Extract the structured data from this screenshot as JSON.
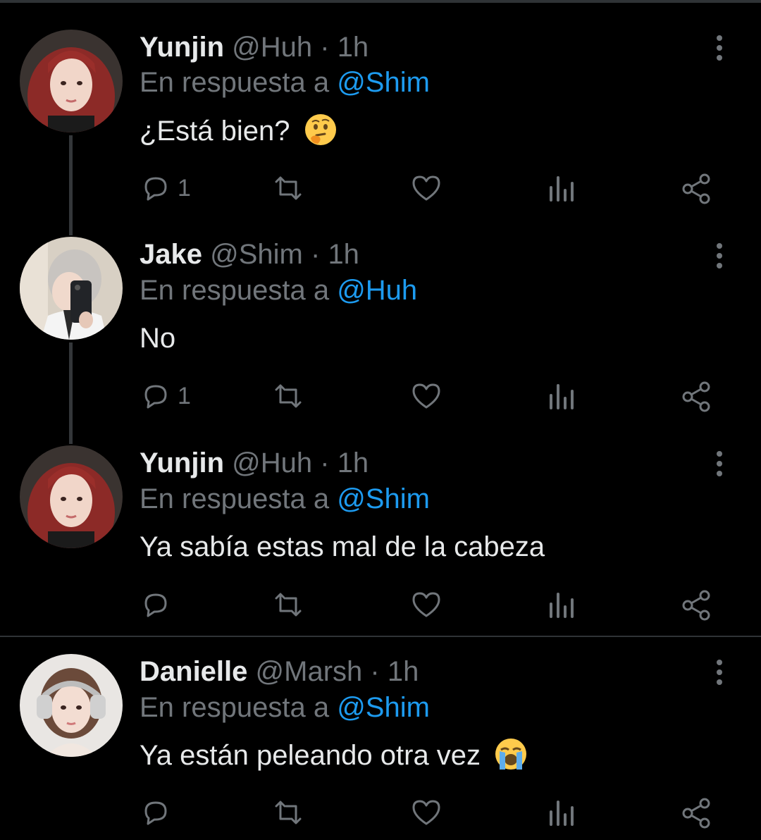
{
  "tweets": [
    {
      "name": "Yunjin",
      "handle": "@Huh",
      "dot": "·",
      "time": "1h",
      "reply_prefix": "En respuesta a",
      "reply_mention": "@Shim",
      "text": "¿Está bien?",
      "emoji": "thinking-face",
      "reply_count": "1",
      "avatar": "avatar-red-hair"
    },
    {
      "name": "Jake",
      "handle": "@Shim",
      "dot": "·",
      "time": "1h",
      "reply_prefix": "En respuesta a",
      "reply_mention": "@Huh",
      "text": "No",
      "emoji": "",
      "reply_count": "1",
      "avatar": "avatar-phone-selfie"
    },
    {
      "name": "Yunjin",
      "handle": "@Huh",
      "dot": "·",
      "time": "1h",
      "reply_prefix": "En respuesta a",
      "reply_mention": "@Shim",
      "text": "Ya sabía estas mal de la cabeza",
      "emoji": "",
      "reply_count": "",
      "avatar": "avatar-red-hair"
    },
    {
      "name": "Danielle",
      "handle": "@Marsh",
      "dot": "·",
      "time": "1h",
      "reply_prefix": "En respuesta a",
      "reply_mention": "@Shim",
      "text": "Ya están peleando otra vez",
      "emoji": "loudly-crying-face",
      "reply_count": "",
      "avatar": "avatar-headphones"
    }
  ],
  "icons": {
    "reply": "reply-icon",
    "retweet": "retweet-icon",
    "like": "heart-icon",
    "views": "views-icon",
    "share": "share-icon",
    "more": "more-vertical-icon"
  },
  "colors": {
    "background": "#000000",
    "text": "#e7e9ea",
    "muted": "#71767b",
    "link": "#1d9bf0",
    "divider": "#2f3336"
  }
}
